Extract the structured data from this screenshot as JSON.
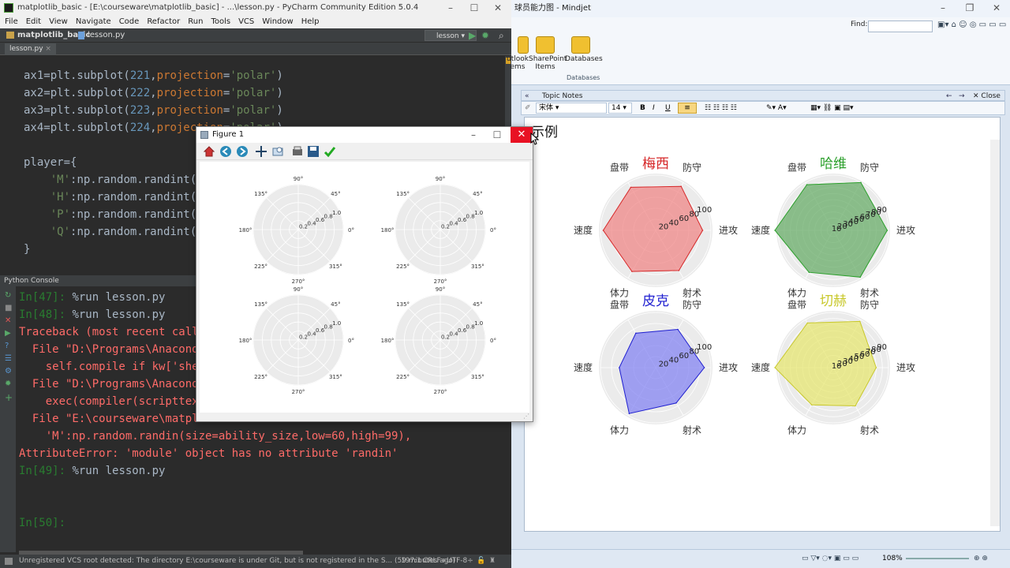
{
  "pycharm": {
    "title": "matplotlib_basic - [E:\\courseware\\matplotlib_basic] - ...\\lesson.py - PyCharm Community Edition 5.0.4",
    "menu": [
      "File",
      "Edit",
      "View",
      "Navigate",
      "Code",
      "Refactor",
      "Run",
      "Tools",
      "VCS",
      "Window",
      "Help"
    ],
    "project": "matplotlib_basic",
    "file": "lesson.py",
    "run_config": "lesson",
    "tab": "lesson.py",
    "code_lines": [
      "ax1=plt.subplot(221,projection='polar')",
      "ax2=plt.subplot(222,projection='polar')",
      "ax3=plt.subplot(223,projection='polar')",
      "ax4=plt.subplot(224,projection='polar')",
      "",
      "player={",
      "    'M':np.random.randint(",
      "    'H':np.random.randint(",
      "    'P':np.random.randint(",
      "    'Q':np.random.randint(",
      "}"
    ],
    "console_title": "Python Console",
    "console": [
      {
        "prompt": "In[47]:",
        "text": " %run lesson.py",
        "cls": ""
      },
      {
        "prompt": "In[48]:",
        "text": " %run lesson.py",
        "cls": ""
      },
      {
        "prompt": "",
        "text": "Traceback (most recent call las",
        "cls": "cerr"
      },
      {
        "prompt": "",
        "text": "  File \"D:\\Programs\\Anaconda\\li",
        "cls": "cerr"
      },
      {
        "prompt": "",
        "text": "    self.compile if kw['shell_f",
        "cls": "cerr"
      },
      {
        "prompt": "",
        "text": "  File \"D:\\Programs\\Anaconda\\li",
        "cls": "cerr"
      },
      {
        "prompt": "",
        "text": "    exec(compiler(scripttext, f",
        "cls": "cerr"
      },
      {
        "prompt": "",
        "text": "  File \"E:\\courseware\\matplotli",
        "cls": "cerr"
      },
      {
        "prompt": "",
        "text": "    'M':np.random.randin(size=ability_size,low=60,high=99),",
        "cls": "cerr"
      },
      {
        "prompt": "",
        "text": "AttributeError: 'module' object has no attribute 'randin'",
        "cls": "cerr"
      },
      {
        "prompt": "In[49]:",
        "text": " %run lesson.py",
        "cls": ""
      },
      {
        "prompt": "",
        "text": "",
        "cls": ""
      },
      {
        "prompt": "",
        "text": "",
        "cls": ""
      },
      {
        "prompt": "In[50]:",
        "text": "",
        "cls": ""
      }
    ],
    "status": "Unregistered VCS root detected: The directory E:\\courseware is under Git, but is not registered in the S... (59 minutes ago)",
    "cursor": "197:1",
    "line_sep": "CRLF÷",
    "encoding": "UTF-8÷"
  },
  "figure": {
    "title": "Figure 1",
    "angle_labels": [
      "90°",
      "45°",
      "0°",
      "315°",
      "270°",
      "225°",
      "180°",
      "135°"
    ],
    "radial_labels": [
      "0.2",
      "0.4",
      "0.6",
      "0.8",
      "1.0"
    ]
  },
  "mindjet": {
    "title": "球员能力图 - Mindjet",
    "find_label": "Find:",
    "ribbon": [
      {
        "label": "utlook\nems"
      },
      {
        "label": "SharePoint\nItems"
      },
      {
        "label": "Databases"
      }
    ],
    "ribbon_group": "Databases",
    "notes_title": "Topic Notes",
    "close_label": "Close",
    "font_name": "宋体",
    "font_size": "14",
    "doc_heading": "示例",
    "zoom": "108%"
  },
  "chart_data": [
    {
      "type": "radar",
      "title": "梅西",
      "color": "#d62728",
      "fill": "#f08080",
      "categories": [
        "进攻",
        "防守",
        "盘带",
        "速度",
        "体力",
        "射术"
      ],
      "radial_ticks": [
        20,
        40,
        60,
        80,
        100
      ],
      "values": [
        85,
        92,
        90,
        95,
        86,
        84
      ]
    },
    {
      "type": "radar",
      "title": "哈维",
      "color": "#2ca02c",
      "fill": "#5fa85f",
      "categories": [
        "进攻",
        "防守",
        "盘带",
        "速度",
        "体力",
        "射术"
      ],
      "radial_ticks": [
        10,
        20,
        30,
        40,
        50,
        60,
        70,
        80,
        90
      ],
      "values": [
        88,
        90,
        86,
        95,
        79,
        88
      ]
    },
    {
      "type": "radar",
      "title": "皮克",
      "color": "#1f1fd0",
      "fill": "#7d7df2",
      "categories": [
        "进攻",
        "防守",
        "盘带",
        "速度",
        "体力",
        "射术"
      ],
      "radial_ticks": [
        20,
        40,
        60,
        80,
        100
      ],
      "values": [
        88,
        80,
        72,
        66,
        96,
        74
      ]
    },
    {
      "type": "radar",
      "title": "切赫",
      "color": "#c8c82a",
      "fill": "#e6e66a",
      "categories": [
        "进攻",
        "防守",
        "盘带",
        "速度",
        "体力",
        "射术"
      ],
      "radial_ticks": [
        10,
        20,
        30,
        40,
        50,
        60,
        70,
        80,
        90
      ],
      "values": [
        70,
        87,
        84,
        95,
        70,
        72
      ]
    }
  ]
}
